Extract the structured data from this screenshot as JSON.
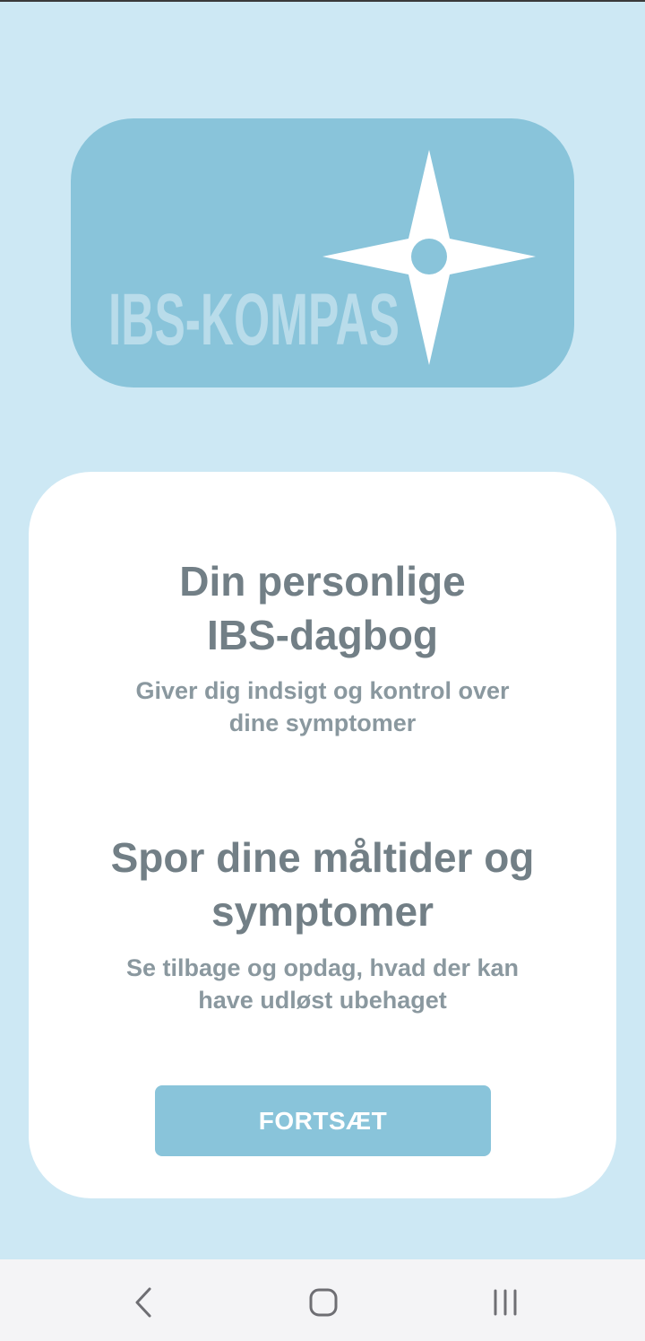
{
  "logo": {
    "text": "IBS-KOMPAS",
    "icon": "compass-star-icon",
    "bg_color": "#89c4da"
  },
  "card": {
    "heading1_line1": "Din personlige",
    "heading1_line2": "IBS-dagbog",
    "sub1_line1": "Giver dig indsigt og kontrol over",
    "sub1_line2": "dine symptomer",
    "heading2_line1": "Spor dine måltider og",
    "heading2_line2": "symptomer",
    "sub2_line1": "Se tilbage og opdag, hvad der kan",
    "sub2_line2": "have udløst ubehaget",
    "continue_label": "FORTSÆT"
  },
  "navbar": {
    "back_icon": "chevron-left-icon",
    "home_icon": "home-icon",
    "recent_icon": "recent-apps-icon"
  },
  "colors": {
    "background": "#cde8f4",
    "accent": "#89c4da",
    "heading_text": "#727f86",
    "sub_text": "#8a989f"
  }
}
